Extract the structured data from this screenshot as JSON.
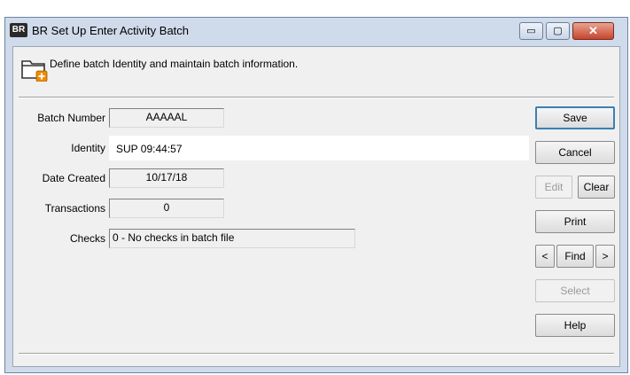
{
  "window": {
    "app_icon": "BR",
    "title": "BR Set Up Enter Activity Batch",
    "controls": {
      "minimize": "▭",
      "maximize": "▢",
      "close": "✕"
    }
  },
  "description": "Define batch Identity and maintain batch information.",
  "fields": {
    "batch_number": {
      "label": "Batch Number",
      "value": "AAAAAL"
    },
    "identity": {
      "label": "Identity",
      "value": "SUP 09:44:57"
    },
    "date_created": {
      "label": "Date Created",
      "value": "10/17/18"
    },
    "transactions": {
      "label": "Transactions",
      "value": "0"
    },
    "checks": {
      "label": "Checks",
      "value": "0 - No checks in batch file"
    }
  },
  "buttons": {
    "save": "Save",
    "cancel": "Cancel",
    "edit": "Edit",
    "clear": "Clear",
    "print": "Print",
    "prev": "<",
    "find": "Find",
    "next": ">",
    "select": "Select",
    "help": "Help"
  },
  "icons": {
    "folder": "folder-add-icon"
  }
}
